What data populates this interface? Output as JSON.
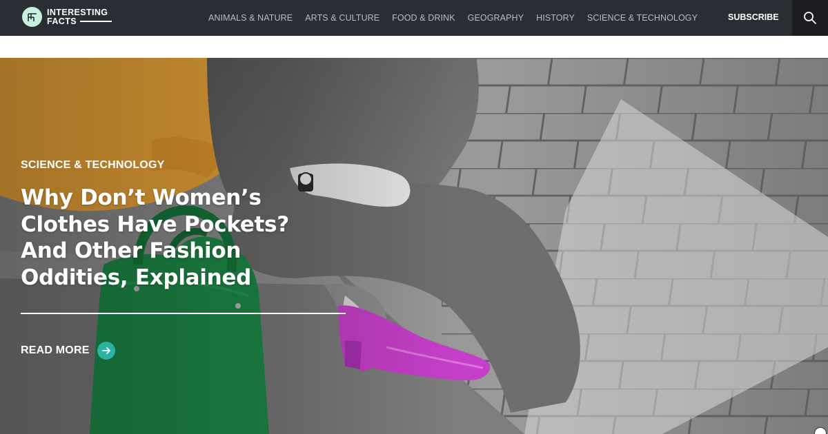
{
  "brand": {
    "line1": "INTERESTING",
    "line2": "FACTS",
    "badge_color": "#c8f0df"
  },
  "nav": {
    "items": [
      {
        "label": "ANIMALS & NATURE"
      },
      {
        "label": "ARTS & CULTURE"
      },
      {
        "label": "FOOD & DRINK"
      },
      {
        "label": "GEOGRAPHY"
      },
      {
        "label": "HISTORY"
      },
      {
        "label": "SCIENCE & TECHNOLOGY"
      }
    ]
  },
  "header": {
    "subscribe_label": "SUBSCRIBE",
    "search_icon": "search-icon",
    "background": "#2a2d33"
  },
  "hero": {
    "category": "SCIENCE & TECHNOLOGY",
    "headline": "Why Don’t Women’s Clothes Have Pockets? And Other Fashion Oddities, Explained",
    "read_more_label": "READ MORE",
    "arrow_icon": "arrow-right-icon",
    "accent": "#2bb3a1"
  }
}
